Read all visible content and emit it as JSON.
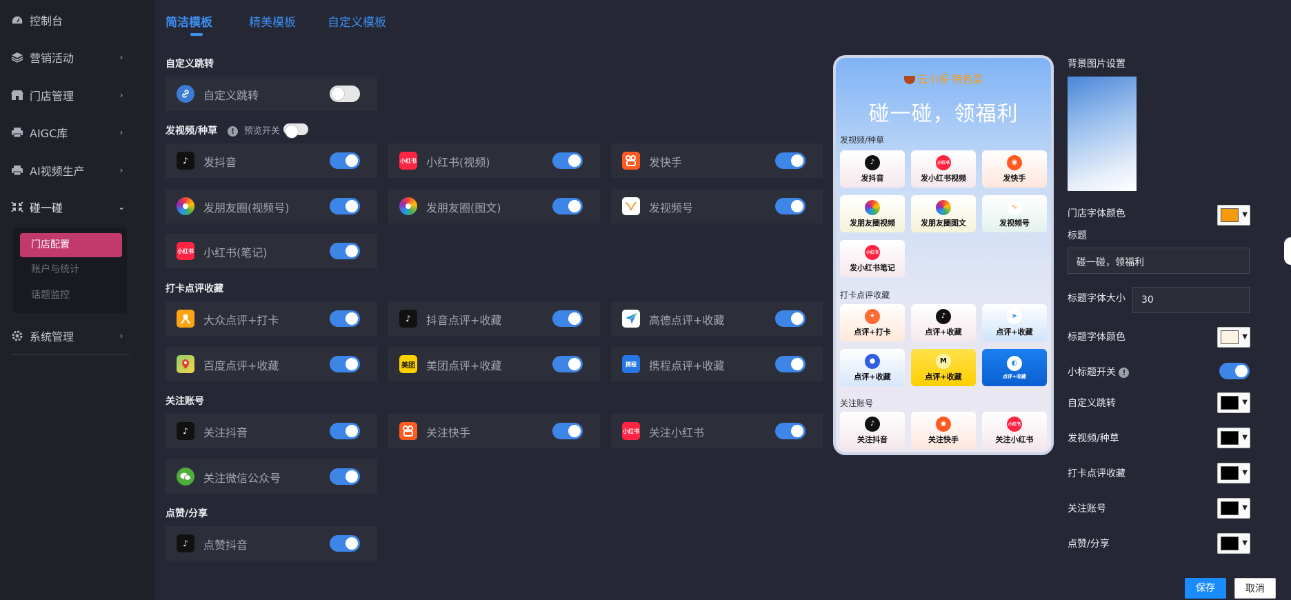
{
  "sidebar": {
    "items": [
      {
        "label": "控制台"
      },
      {
        "label": "营销活动"
      },
      {
        "label": "门店管理"
      },
      {
        "label": "AIGC库"
      },
      {
        "label": "AI视频生产"
      },
      {
        "label": "碰一碰"
      },
      {
        "label": "系统管理"
      }
    ],
    "subitems": [
      {
        "label": "门店配置"
      },
      {
        "label": "账户与统计"
      },
      {
        "label": "话题监控"
      }
    ]
  },
  "tabs": [
    {
      "label": "简洁模板"
    },
    {
      "label": "精美模板"
    },
    {
      "label": "自定义模板"
    }
  ],
  "sections": {
    "custom_jump": {
      "title": "自定义跳转",
      "items": [
        {
          "label": "自定义跳转",
          "on": false
        }
      ]
    },
    "video": {
      "title": "发视频/种草",
      "preview_label": "预览开关",
      "items": [
        {
          "label": "发抖音",
          "on": true
        },
        {
          "label": "小红书(视频)",
          "on": true
        },
        {
          "label": "发快手",
          "on": true
        },
        {
          "label": "发朋友圈(视频号)",
          "on": true
        },
        {
          "label": "发朋友圈(图文)",
          "on": true
        },
        {
          "label": "发视频号",
          "on": true
        },
        {
          "label": "小红书(笔记)",
          "on": true
        }
      ]
    },
    "checkin": {
      "title": "打卡点评收藏",
      "items": [
        {
          "label": "大众点评+打卡",
          "on": true
        },
        {
          "label": "抖音点评+收藏",
          "on": true
        },
        {
          "label": "高德点评+收藏",
          "on": true
        },
        {
          "label": "百度点评+收藏",
          "on": true
        },
        {
          "label": "美团点评+收藏",
          "on": true
        },
        {
          "label": "携程点评+收藏",
          "on": true
        }
      ]
    },
    "follow": {
      "title": "关注账号",
      "items": [
        {
          "label": "关注抖音",
          "on": true
        },
        {
          "label": "关注快手",
          "on": true
        },
        {
          "label": "关注小红书",
          "on": true
        },
        {
          "label": "关注微信公众号",
          "on": true
        }
      ]
    },
    "like": {
      "title": "点赞/分享",
      "items": [
        {
          "label": "点赞抖音",
          "on": true
        }
      ]
    }
  },
  "icon_text": {
    "xhs": "小红书",
    "meituan": "美团",
    "ctrip": "携程"
  },
  "preview": {
    "brand": "云小探·特色菜",
    "title": "碰一碰，领福利",
    "sections": [
      "发视频/种草",
      "打卡点评收藏",
      "关注账号"
    ],
    "video_tiles": [
      "发抖音",
      "发小红书视频",
      "发快手",
      "发朋友圈视频",
      "发朋友圈图文",
      "发视频号",
      "发小红书笔记"
    ],
    "checkin_tiles": [
      "点评+打卡",
      "点评+收藏",
      "点评+收藏",
      "点评+收藏",
      "点评+收藏",
      "点评+收藏"
    ],
    "follow_tiles": [
      "关注抖音",
      "关注快手",
      "关注小红书"
    ]
  },
  "settings": {
    "bg_label": "背景图片设置",
    "store_font_color_label": "门店字体颜色",
    "store_font_color": "#f59a0c",
    "title_label": "标题",
    "title_value": "碰一碰，领福利",
    "title_size_label": "标题字体大小",
    "title_size_value": "30",
    "title_color_label": "标题字体颜色",
    "title_color": "#fdf4e6",
    "subtitle_switch_label": "小标题开关",
    "subtitle_switch_on": true,
    "colors": [
      {
        "label": "自定义跳转",
        "color": "#000000"
      },
      {
        "label": "发视频/种草",
        "color": "#000000"
      },
      {
        "label": "打卡点评收藏",
        "color": "#000000"
      },
      {
        "label": "关注账号",
        "color": "#000000"
      },
      {
        "label": "点赞/分享",
        "color": "#000000"
      }
    ]
  },
  "footer": {
    "save": "保存",
    "cancel": "取消"
  },
  "colors": {
    "accent": "#3d86e8",
    "active_sub": "#c2396c",
    "save_btn": "#1a8cff"
  }
}
